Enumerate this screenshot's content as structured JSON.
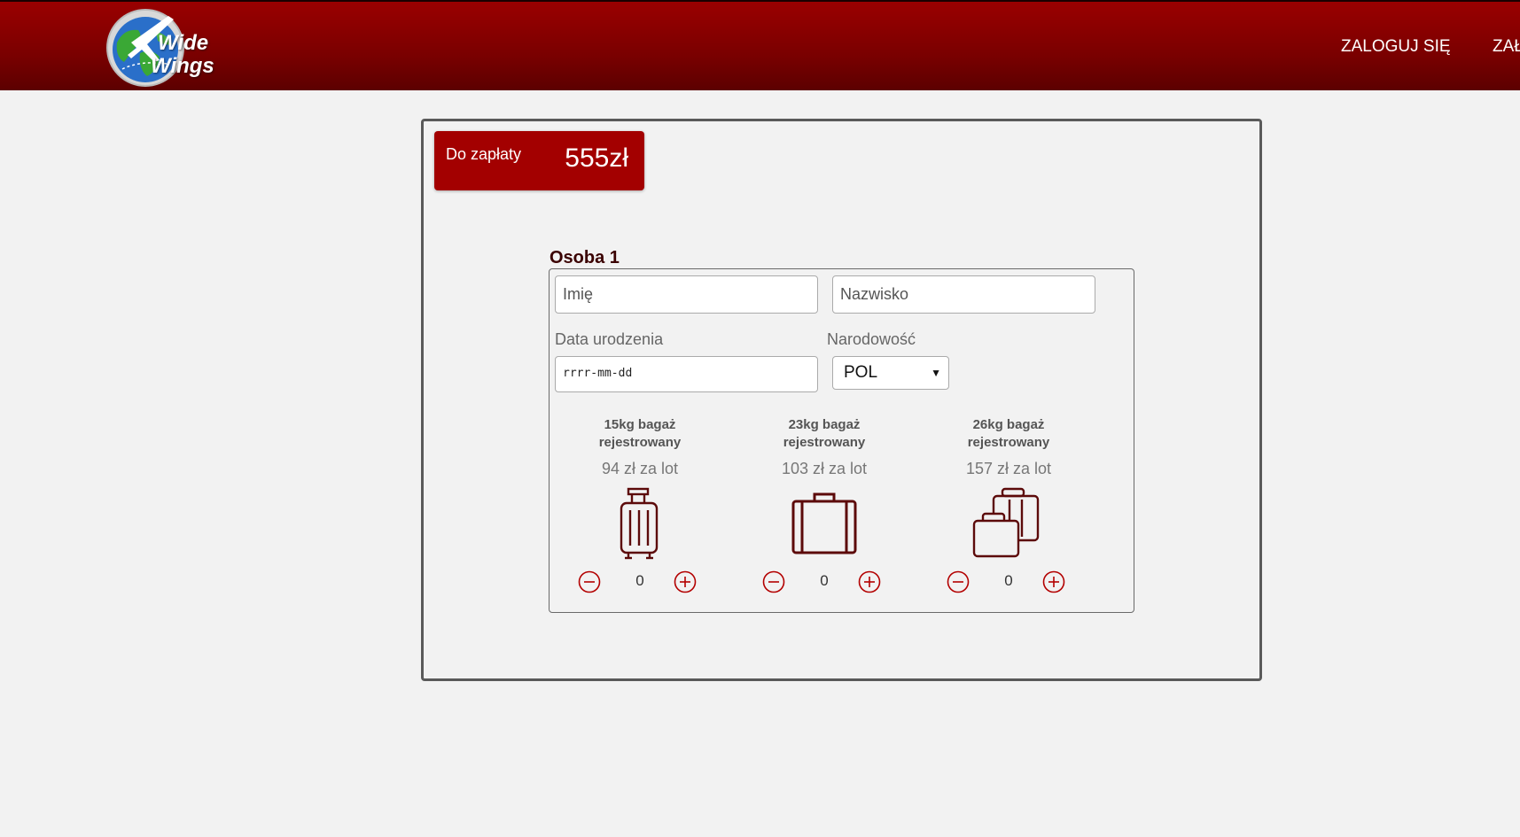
{
  "brand": {
    "line1": "Wide",
    "line2": "Wings"
  },
  "nav": {
    "login": "ZALOGUJ SIĘ",
    "register": "ZAŁ"
  },
  "payment": {
    "label": "Do zapłaty",
    "amount": "555zł"
  },
  "person": {
    "title": "Osoba 1",
    "first_name_placeholder": "Imię",
    "last_name_placeholder": "Nazwisko",
    "birthdate_label": "Data urodzenia",
    "birthdate_placeholder": "rrrr-mm-dd",
    "nationality_label": "Narodowość",
    "nationality_value": "POL"
  },
  "baggage": [
    {
      "line1": "15kg bagaż",
      "line2": "rejestrowany",
      "price": "94 zł za lot",
      "qty": "0",
      "icon": "trolley-suitcase-icon"
    },
    {
      "line1": "23kg bagaż",
      "line2": "rejestrowany",
      "price": "103 zł za lot",
      "qty": "0",
      "icon": "suitcase-icon"
    },
    {
      "line1": "26kg bagaż",
      "line2": "rejestrowany",
      "price": "157 zł za lot",
      "qty": "0",
      "icon": "luggage-set-icon"
    }
  ],
  "colors": {
    "header": "#8b0000",
    "accent": "#a30000",
    "icon": "#5c0a0a",
    "ctrl": "#b30000"
  }
}
